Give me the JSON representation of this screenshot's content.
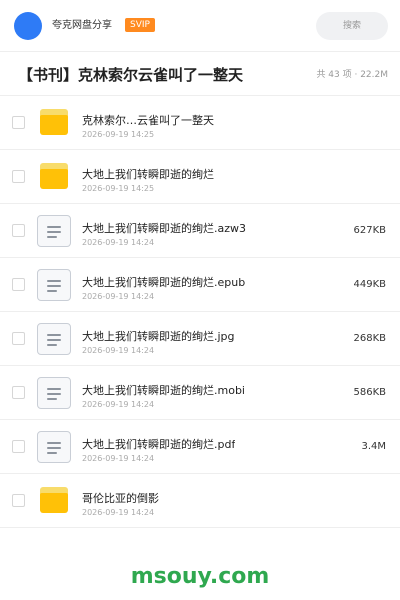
{
  "header": {
    "app_name": "夸克网盘分享",
    "badge": "SVIP",
    "search_placeholder": "搜索",
    "colors": {
      "avatar": "#2e7bf6",
      "badge": "#ff8a1f"
    }
  },
  "folder": {
    "title": "【书刊】克林索尔云雀叫了一整天",
    "stats": "共 43 项 · 22.2M"
  },
  "files": [
    {
      "type": "folder",
      "name": "克林索尔…云雀叫了一整天",
      "date": "2026-09-19 14:25",
      "size": ""
    },
    {
      "type": "folder",
      "name": "大地上我们转瞬即逝的绚烂",
      "date": "2026-09-19 14:25",
      "size": ""
    },
    {
      "type": "doc",
      "name": "大地上我们转瞬即逝的绚烂.azw3",
      "date": "2026-09-19 14:24",
      "size": "627KB"
    },
    {
      "type": "doc",
      "name": "大地上我们转瞬即逝的绚烂.epub",
      "date": "2026-09-19 14:24",
      "size": "449KB"
    },
    {
      "type": "doc",
      "name": "大地上我们转瞬即逝的绚烂.jpg",
      "date": "2026-09-19 14:24",
      "size": "268KB"
    },
    {
      "type": "doc",
      "name": "大地上我们转瞬即逝的绚烂.mobi",
      "date": "2026-09-19 14:24",
      "size": "586KB"
    },
    {
      "type": "doc",
      "name": "大地上我们转瞬即逝的绚烂.pdf",
      "date": "2026-09-19 14:24",
      "size": "3.4M"
    },
    {
      "type": "folder",
      "name": "哥伦比亚的倒影",
      "date": "2026-09-19 14:24",
      "size": ""
    }
  ],
  "watermark": "msouy.com"
}
